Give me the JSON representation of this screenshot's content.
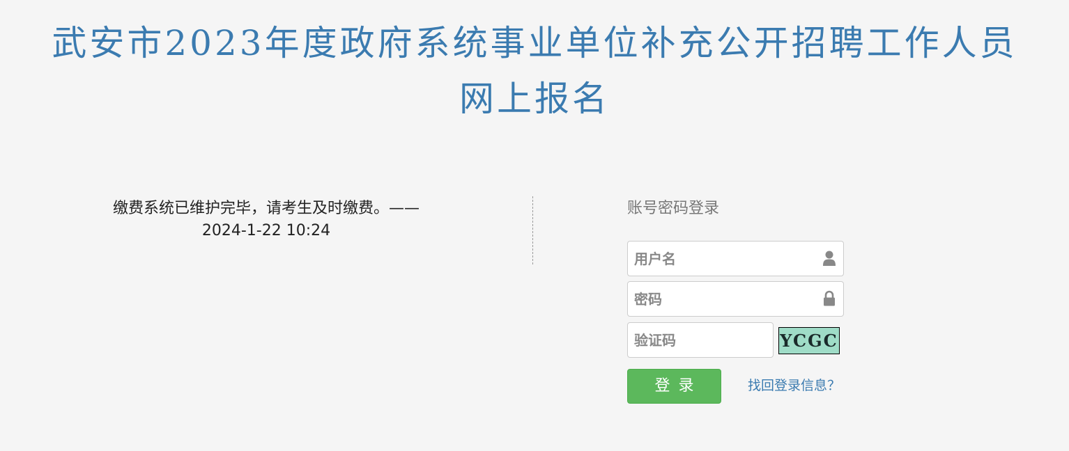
{
  "header": {
    "title_line1": "武安市2023年度政府系统事业单位补充公开招聘工作人员",
    "title_line2": "网上报名"
  },
  "notice": {
    "text": "缴费系统已维护完毕，请考生及时缴费。——",
    "timestamp": "2024-1-22 10:24"
  },
  "login": {
    "heading": "账号密码登录",
    "username_placeholder": "用户名",
    "password_placeholder": "密码",
    "captcha_placeholder": "验证码",
    "captcha_text": "YCGC",
    "submit_label": "登录",
    "recover_link": "找回登录信息？"
  },
  "icons": {
    "username": "user-icon",
    "password": "lock-icon"
  },
  "colors": {
    "title": "#3b7bb0",
    "button": "#5cb85c",
    "link": "#3b7bb0",
    "captcha_bg": "#9fdcc7"
  }
}
